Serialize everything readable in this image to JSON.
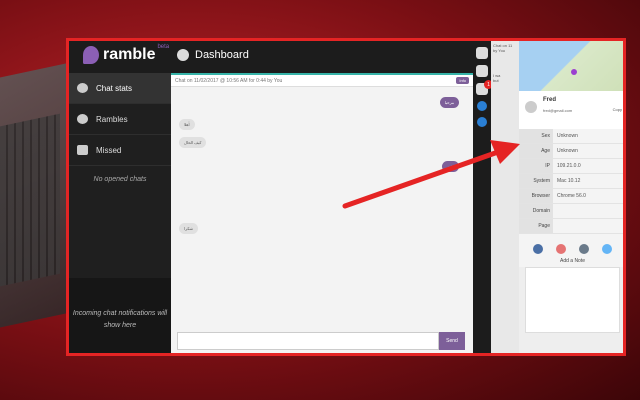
{
  "app": {
    "logo_text": "ramble",
    "logo_badge": "beta",
    "page_title": "Dashboard"
  },
  "sidebar": {
    "items": [
      {
        "label": "Chat stats",
        "icon": "dashboard-icon"
      },
      {
        "label": "Rambles",
        "icon": "chat-bubbles-icon"
      },
      {
        "label": "Missed",
        "icon": "envelope-icon"
      }
    ],
    "empty_text": "No opened chats",
    "notice_text": "Incoming chat notifications will show here"
  },
  "chat": {
    "header_text": "Chat on 11/02/2017 @ 10:56 AM for 0:44 by You",
    "info_label": "Info",
    "send_label": "Send",
    "messages": [
      {
        "text": "مرحبا",
        "dir": "out"
      },
      {
        "text": "أهلا",
        "dir": "in"
      },
      {
        "text": "كيف الحال",
        "dir": "in"
      },
      {
        "text": "بخير",
        "dir": "out"
      },
      {
        "text": "شكرا",
        "dir": "in"
      }
    ]
  },
  "iconbar": {
    "badge_count": "1"
  },
  "preview": {
    "line1": "Chat on 11",
    "line2": "by You",
    "line3": "I wa",
    "line4": "but"
  },
  "visitor": {
    "name": "Fred",
    "email": "fred@gmail.com",
    "copy_label": "Copy",
    "fields": [
      {
        "label": "Sex",
        "value": "Unknown"
      },
      {
        "label": "Age",
        "value": "Unknown"
      },
      {
        "label": "IP",
        "value": "109.21.0.0"
      },
      {
        "label": "System",
        "value": "Mac 10.12"
      },
      {
        "label": "Browser",
        "value": "Chrome 56.0"
      },
      {
        "label": "Domain",
        "value": ""
      },
      {
        "label": "Page",
        "value": ""
      }
    ],
    "add_note_label": "Add a Note",
    "action_colors": [
      "#4a6fa5",
      "#e57373",
      "#6a7a8a",
      "#64b5f6"
    ]
  },
  "colors": {
    "accent": "#7d5f99",
    "highlight_border": "#e52424",
    "tab_blue": "#2a7fd4"
  }
}
